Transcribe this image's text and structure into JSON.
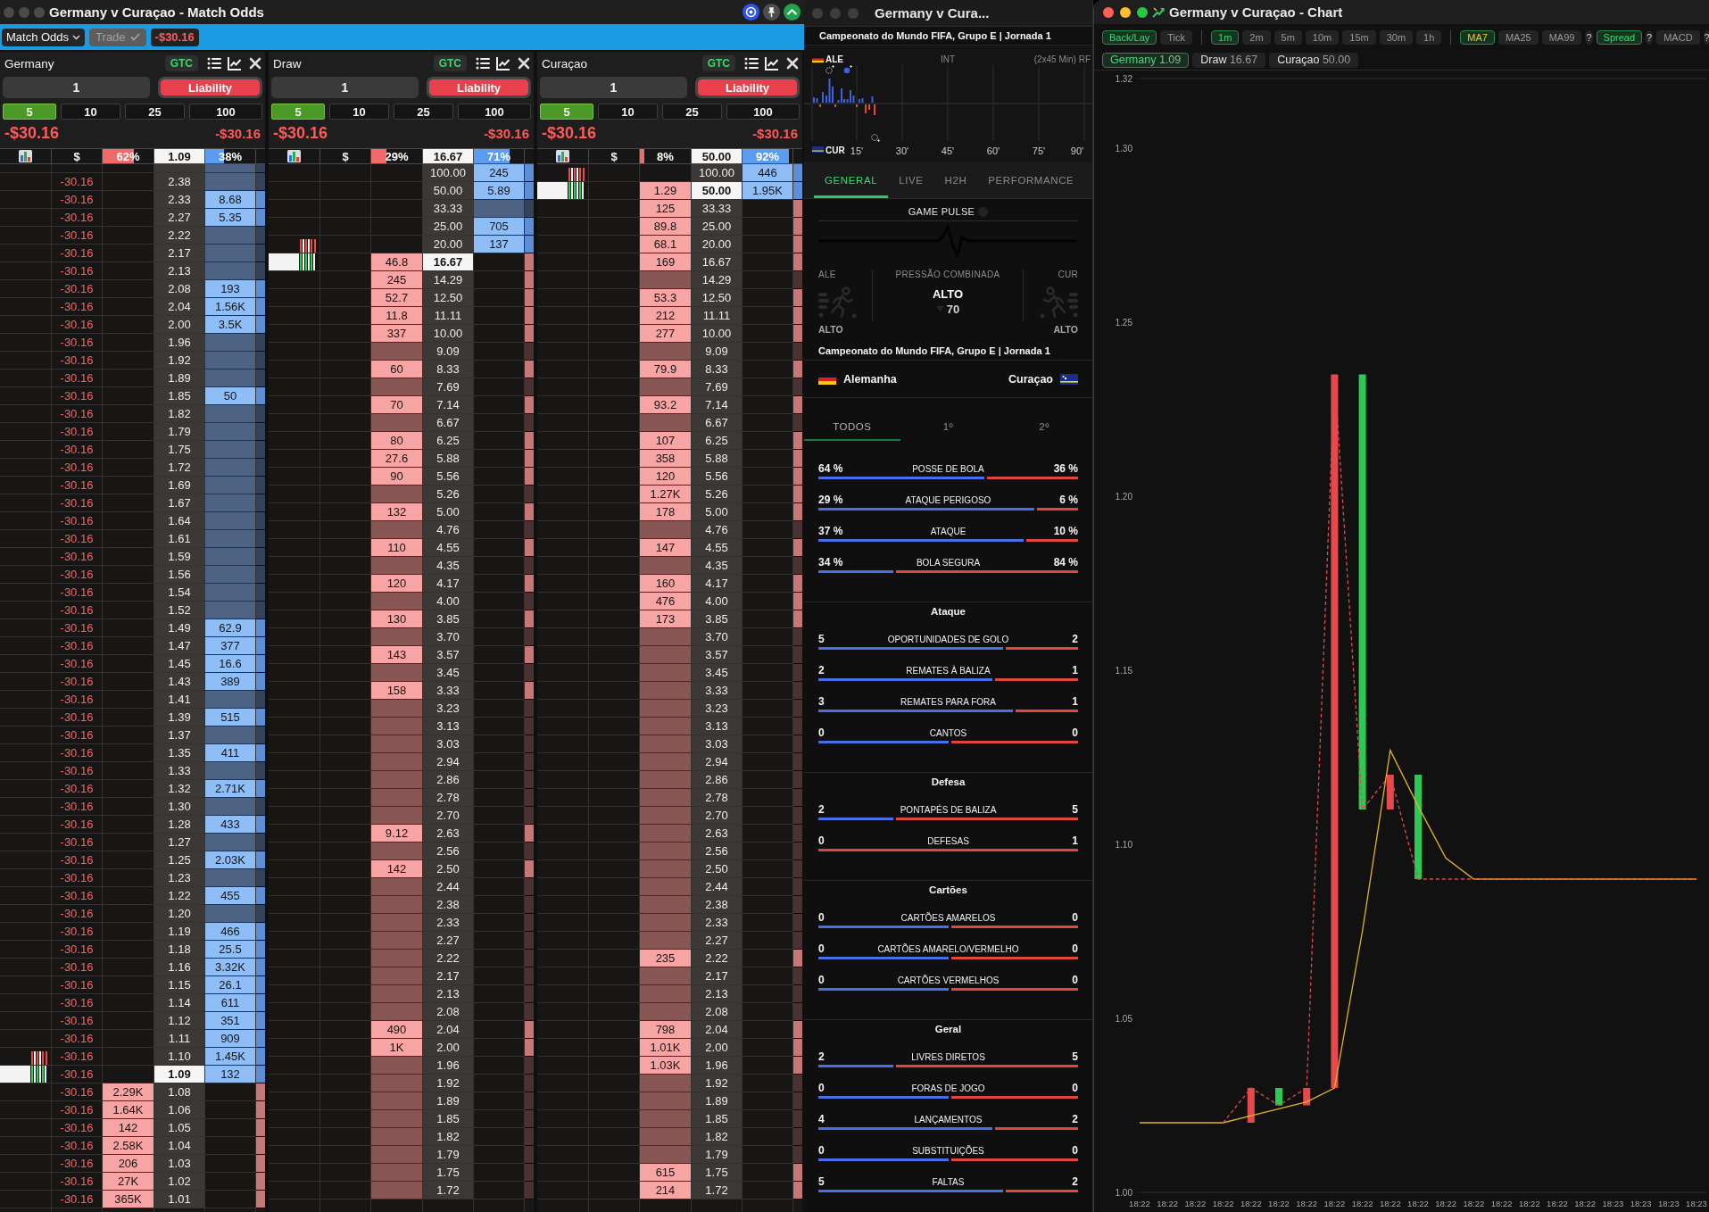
{
  "match_window": {
    "title": "Germany v Curaçao - Match Odds",
    "toolbar": {
      "market": "Match Odds",
      "trade": {
        "label": "Trade",
        "disabled": true
      },
      "total_pl": "-$30.16"
    },
    "ladders": [
      {
        "runner": "Germany",
        "order_type": "GTC",
        "quantity": "1",
        "stake_mode": "Liability",
        "stakes": [
          {
            "label": "5",
            "selected": true
          },
          {
            "label": "10",
            "selected": false
          },
          {
            "label": "25",
            "selected": false
          },
          {
            "label": "100",
            "selected": false
          }
        ],
        "pl": "-$30.16",
        "liability": "-$30.16",
        "columns": {
          "pl": "$",
          "lay_share": {
            "text": "62%",
            "level": 0.62
          },
          "last_price": "1.09",
          "back_share": {
            "text": "38%",
            "level": 0.38
          }
        },
        "half_row_at_top": true,
        "rows": [
          {
            "pl": "-30.16",
            "price": "2.38",
            "ltp": false
          },
          {
            "pl": "-30.16",
            "price": "2.33",
            "back": "8.68",
            "ltp": false
          },
          {
            "pl": "-30.16",
            "price": "2.27",
            "back": "5.35",
            "ltp": false
          },
          {
            "pl": "-30.16",
            "price": "2.22",
            "ltp": false
          },
          {
            "pl": "-30.16",
            "price": "2.17",
            "ltp": false
          },
          {
            "pl": "-30.16",
            "price": "2.13",
            "ltp": false
          },
          {
            "pl": "-30.16",
            "price": "2.08",
            "back": "193",
            "ltp": false
          },
          {
            "pl": "-30.16",
            "price": "2.04",
            "back": "1.56K",
            "ltp": false
          },
          {
            "pl": "-30.16",
            "price": "2.00",
            "back": "3.5K",
            "ltp": false
          },
          {
            "pl": "-30.16",
            "price": "1.96",
            "ltp": false
          },
          {
            "pl": "-30.16",
            "price": "1.92",
            "ltp": false
          },
          {
            "pl": "-30.16",
            "price": "1.89",
            "ltp": false
          },
          {
            "pl": "-30.16",
            "price": "1.85",
            "back": "50",
            "ltp": false
          },
          {
            "pl": "-30.16",
            "price": "1.82",
            "ltp": false
          },
          {
            "pl": "-30.16",
            "price": "1.79",
            "ltp": false
          },
          {
            "pl": "-30.16",
            "price": "1.75",
            "ltp": false
          },
          {
            "pl": "-30.16",
            "price": "1.72",
            "ltp": false
          },
          {
            "pl": "-30.16",
            "price": "1.69",
            "ltp": false
          },
          {
            "pl": "-30.16",
            "price": "1.67",
            "ltp": false
          },
          {
            "pl": "-30.16",
            "price": "1.64",
            "ltp": false
          },
          {
            "pl": "-30.16",
            "price": "1.61",
            "ltp": false
          },
          {
            "pl": "-30.16",
            "price": "1.59",
            "ltp": false
          },
          {
            "pl": "-30.16",
            "price": "1.56",
            "ltp": false
          },
          {
            "pl": "-30.16",
            "price": "1.54",
            "ltp": false
          },
          {
            "pl": "-30.16",
            "price": "1.52",
            "ltp": false
          },
          {
            "pl": "-30.16",
            "price": "1.49",
            "back": "62.9",
            "ltp": false
          },
          {
            "pl": "-30.16",
            "price": "1.47",
            "back": "377",
            "ltp": false
          },
          {
            "pl": "-30.16",
            "price": "1.45",
            "back": "16.6",
            "ltp": false
          },
          {
            "pl": "-30.16",
            "price": "1.43",
            "back": "389",
            "ltp": false
          },
          {
            "pl": "-30.16",
            "price": "1.41",
            "ltp": false
          },
          {
            "pl": "-30.16",
            "price": "1.39",
            "back": "515",
            "ltp": false
          },
          {
            "pl": "-30.16",
            "price": "1.37",
            "ltp": false
          },
          {
            "pl": "-30.16",
            "price": "1.35",
            "back": "411",
            "ltp": false
          },
          {
            "pl": "-30.16",
            "price": "1.33",
            "ltp": false
          },
          {
            "pl": "-30.16",
            "price": "1.32",
            "back": "2.71K",
            "ltp": false
          },
          {
            "pl": "-30.16",
            "price": "1.30",
            "ltp": false
          },
          {
            "pl": "-30.16",
            "price": "1.28",
            "back": "433",
            "ltp": false
          },
          {
            "pl": "-30.16",
            "price": "1.27",
            "ltp": false
          },
          {
            "pl": "-30.16",
            "price": "1.25",
            "back": "2.03K",
            "ltp": false
          },
          {
            "pl": "-30.16",
            "price": "1.23",
            "ltp": false
          },
          {
            "pl": "-30.16",
            "price": "1.22",
            "back": "455",
            "ltp": false
          },
          {
            "pl": "-30.16",
            "price": "1.20",
            "ltp": false
          },
          {
            "pl": "-30.16",
            "price": "1.19",
            "back": "466",
            "ltp": false
          },
          {
            "pl": "-30.16",
            "price": "1.18",
            "back": "25.5",
            "ltp": false
          },
          {
            "pl": "-30.16",
            "price": "1.16",
            "back": "3.32K",
            "ltp": false
          },
          {
            "pl": "-30.16",
            "price": "1.15",
            "back": "26.1",
            "ltp": false
          },
          {
            "pl": "-30.16",
            "price": "1.14",
            "back": "611",
            "ltp": false
          },
          {
            "pl": "-30.16",
            "price": "1.12",
            "back": "351",
            "ltp": false
          },
          {
            "pl": "-30.16",
            "price": "1.11",
            "back": "909",
            "ltp": false
          },
          {
            "pl": "-30.16",
            "price": "1.10",
            "back": "1.45K",
            "ltp": false
          },
          {
            "pl": "-30.16",
            "price": "1.09",
            "back": "132",
            "ltp": true
          },
          {
            "pl": "-30.16",
            "lay": "2.29K",
            "price": "1.08",
            "ltp": false
          },
          {
            "pl": "-30.16",
            "lay": "1.64K",
            "price": "1.06",
            "ltp": false
          },
          {
            "pl": "-30.16",
            "lay": "142",
            "price": "1.05",
            "ltp": false
          },
          {
            "pl": "-30.16",
            "lay": "2.58K",
            "price": "1.04",
            "ltp": false
          },
          {
            "pl": "-30.16",
            "lay": "206",
            "price": "1.03",
            "ltp": false
          },
          {
            "pl": "-30.16",
            "lay": "27K",
            "price": "1.02",
            "ltp": false
          },
          {
            "pl": "-30.16",
            "lay": "365K",
            "price": "1.01",
            "ltp": false
          }
        ]
      },
      {
        "runner": "Draw",
        "order_type": "GTC",
        "quantity": "1",
        "stake_mode": "Liability",
        "stakes": [
          {
            "label": "5",
            "selected": true
          },
          {
            "label": "10",
            "selected": false
          },
          {
            "label": "25",
            "selected": false
          },
          {
            "label": "100",
            "selected": false
          }
        ],
        "pl": "-$30.16",
        "liability": "-$30.16",
        "columns": {
          "pl": "$",
          "lay_share": {
            "text": "29%",
            "level": 0.29
          },
          "last_price": "16.67",
          "back_share": {
            "text": "71%",
            "level": 0.71
          }
        },
        "half_row_at_top": false,
        "rows": [
          {
            "price": "100.00",
            "back": "245",
            "ltp": false
          },
          {
            "price": "50.00",
            "back": "5.89",
            "ltp": false
          },
          {
            "price": "33.33",
            "ltp": false
          },
          {
            "price": "25.00",
            "back": "705",
            "ltp": false
          },
          {
            "price": "20.00",
            "back": "137",
            "ltp": false
          },
          {
            "lay": "46.8",
            "price": "16.67",
            "ltp": true
          },
          {
            "lay": "245",
            "price": "14.29",
            "ltp": false
          },
          {
            "lay": "52.7",
            "price": "12.50",
            "ltp": false
          },
          {
            "lay": "11.8",
            "price": "11.11",
            "ltp": false
          },
          {
            "lay": "337",
            "price": "10.00",
            "ltp": false
          },
          {
            "price": "9.09",
            "ltp": false
          },
          {
            "lay": "60",
            "price": "8.33",
            "ltp": false
          },
          {
            "price": "7.69",
            "ltp": false
          },
          {
            "lay": "70",
            "price": "7.14",
            "ltp": false
          },
          {
            "price": "6.67",
            "ltp": false
          },
          {
            "lay": "80",
            "price": "6.25",
            "ltp": false
          },
          {
            "lay": "27.6",
            "price": "5.88",
            "ltp": false
          },
          {
            "lay": "90",
            "price": "5.56",
            "ltp": false
          },
          {
            "price": "5.26",
            "ltp": false
          },
          {
            "lay": "132",
            "price": "5.00",
            "ltp": false
          },
          {
            "price": "4.76",
            "ltp": false
          },
          {
            "lay": "110",
            "price": "4.55",
            "ltp": false
          },
          {
            "price": "4.35",
            "ltp": false
          },
          {
            "lay": "120",
            "price": "4.17",
            "ltp": false
          },
          {
            "price": "4.00",
            "ltp": false
          },
          {
            "lay": "130",
            "price": "3.85",
            "ltp": false
          },
          {
            "price": "3.70",
            "ltp": false
          },
          {
            "lay": "143",
            "price": "3.57",
            "ltp": false
          },
          {
            "price": "3.45",
            "ltp": false
          },
          {
            "lay": "158",
            "price": "3.33",
            "ltp": false
          },
          {
            "price": "3.23",
            "ltp": false
          },
          {
            "price": "3.13",
            "ltp": false
          },
          {
            "price": "3.03",
            "ltp": false
          },
          {
            "price": "2.94",
            "ltp": false
          },
          {
            "price": "2.86",
            "ltp": false
          },
          {
            "price": "2.78",
            "ltp": false
          },
          {
            "price": "2.70",
            "ltp": false
          },
          {
            "lay": "9.12",
            "price": "2.63",
            "ltp": false
          },
          {
            "price": "2.56",
            "ltp": false
          },
          {
            "lay": "142",
            "price": "2.50",
            "ltp": false
          },
          {
            "price": "2.44",
            "ltp": false
          },
          {
            "price": "2.38",
            "ltp": false
          },
          {
            "price": "2.33",
            "ltp": false
          },
          {
            "price": "2.27",
            "ltp": false
          },
          {
            "price": "2.22",
            "ltp": false
          },
          {
            "price": "2.17",
            "ltp": false
          },
          {
            "price": "2.13",
            "ltp": false
          },
          {
            "price": "2.08",
            "ltp": false
          },
          {
            "lay": "490",
            "price": "2.04",
            "ltp": false
          },
          {
            "lay": "1K",
            "price": "2.00",
            "ltp": false
          },
          {
            "price": "1.96",
            "ltp": false
          },
          {
            "price": "1.92",
            "ltp": false
          },
          {
            "price": "1.89",
            "ltp": false
          },
          {
            "price": "1.85",
            "ltp": false
          },
          {
            "price": "1.82",
            "ltp": false
          },
          {
            "price": "1.79",
            "ltp": false
          },
          {
            "price": "1.75",
            "ltp": false
          },
          {
            "price": "1.72",
            "ltp": false
          }
        ]
      },
      {
        "runner": "Curaçao",
        "order_type": "GTC",
        "quantity": "1",
        "stake_mode": "Liability",
        "stakes": [
          {
            "label": "5",
            "selected": true
          },
          {
            "label": "10",
            "selected": false
          },
          {
            "label": "25",
            "selected": false
          },
          {
            "label": "100",
            "selected": false
          }
        ],
        "pl": "-$30.16",
        "liability": "-$30.16",
        "columns": {
          "pl": "$",
          "lay_share": {
            "text": "8%",
            "level": 0.08
          },
          "last_price": "50.00",
          "back_share": {
            "text": "92%",
            "level": 0.92
          }
        },
        "half_row_at_top": false,
        "rows": [
          {
            "price": "100.00",
            "back": "446",
            "ltp": false
          },
          {
            "lay": "1.29",
            "price": "50.00",
            "back": "1.95K",
            "ltp": true
          },
          {
            "lay": "125",
            "price": "33.33",
            "ltp": false
          },
          {
            "lay": "89.8",
            "price": "25.00",
            "ltp": false
          },
          {
            "lay": "68.1",
            "price": "20.00",
            "ltp": false
          },
          {
            "lay": "169",
            "price": "16.67",
            "ltp": false
          },
          {
            "price": "14.29",
            "ltp": false
          },
          {
            "lay": "53.3",
            "price": "12.50",
            "ltp": false
          },
          {
            "lay": "212",
            "price": "11.11",
            "ltp": false
          },
          {
            "lay": "277",
            "price": "10.00",
            "ltp": false
          },
          {
            "price": "9.09",
            "ltp": false
          },
          {
            "lay": "79.9",
            "price": "8.33",
            "ltp": false
          },
          {
            "price": "7.69",
            "ltp": false
          },
          {
            "lay": "93.2",
            "price": "7.14",
            "ltp": false
          },
          {
            "price": "6.67",
            "ltp": false
          },
          {
            "lay": "107",
            "price": "6.25",
            "ltp": false
          },
          {
            "lay": "358",
            "price": "5.88",
            "ltp": false
          },
          {
            "lay": "120",
            "price": "5.56",
            "ltp": false
          },
          {
            "lay": "1.27K",
            "price": "5.26",
            "ltp": false
          },
          {
            "lay": "178",
            "price": "5.00",
            "ltp": false
          },
          {
            "price": "4.76",
            "ltp": false
          },
          {
            "lay": "147",
            "price": "4.55",
            "ltp": false
          },
          {
            "price": "4.35",
            "ltp": false
          },
          {
            "lay": "160",
            "price": "4.17",
            "ltp": false
          },
          {
            "lay": "476",
            "price": "4.00",
            "ltp": false
          },
          {
            "lay": "173",
            "price": "3.85",
            "ltp": false
          },
          {
            "price": "3.70",
            "ltp": false
          },
          {
            "price": "3.57",
            "ltp": false
          },
          {
            "price": "3.45",
            "ltp": false
          },
          {
            "price": "3.33",
            "ltp": false
          },
          {
            "price": "3.23",
            "ltp": false
          },
          {
            "price": "3.13",
            "ltp": false
          },
          {
            "price": "3.03",
            "ltp": false
          },
          {
            "price": "2.94",
            "ltp": false
          },
          {
            "price": "2.86",
            "ltp": false
          },
          {
            "price": "2.78",
            "ltp": false
          },
          {
            "price": "2.70",
            "ltp": false
          },
          {
            "price": "2.63",
            "ltp": false
          },
          {
            "price": "2.56",
            "ltp": false
          },
          {
            "price": "2.50",
            "ltp": false
          },
          {
            "price": "2.44",
            "ltp": false
          },
          {
            "price": "2.38",
            "ltp": false
          },
          {
            "price": "2.33",
            "ltp": false
          },
          {
            "price": "2.27",
            "ltp": false
          },
          {
            "lay": "235",
            "price": "2.22",
            "ltp": false
          },
          {
            "price": "2.17",
            "ltp": false
          },
          {
            "price": "2.13",
            "ltp": false
          },
          {
            "price": "2.08",
            "ltp": false
          },
          {
            "lay": "798",
            "price": "2.04",
            "ltp": false
          },
          {
            "lay": "1.01K",
            "price": "2.00",
            "ltp": false
          },
          {
            "lay": "1.03K",
            "price": "1.96",
            "ltp": false
          },
          {
            "price": "1.92",
            "ltp": false
          },
          {
            "price": "1.89",
            "ltp": false
          },
          {
            "price": "1.85",
            "ltp": false
          },
          {
            "price": "1.82",
            "ltp": false
          },
          {
            "price": "1.79",
            "ltp": false
          },
          {
            "lay": "615",
            "price": "1.75",
            "ltp": false
          },
          {
            "lay": "214",
            "price": "1.72",
            "ltp": false
          }
        ]
      }
    ]
  },
  "stats_window": {
    "title": "Germany v Cura...",
    "competition": "Campeonato do Mundo FIFA, Grupo E | Jornada 1",
    "momentum": {
      "home": "ALE",
      "away": "CUR",
      "period": "INT",
      "format": "(2x45 Min) RF",
      "minutes": [
        "15'",
        "30'",
        "45'",
        "60'",
        "75'",
        "90'"
      ]
    },
    "tabs": [
      {
        "label": "GENERAL",
        "selected": true
      },
      {
        "label": "LIVE",
        "selected": false
      },
      {
        "label": "H2H",
        "selected": false
      },
      {
        "label": "PERFORMANCE",
        "selected": false
      }
    ],
    "pulse": {
      "title": "GAME PULSE",
      "home": "ALE",
      "label": "PRESSÃO COMBINADA",
      "away": "CUR",
      "rating": "ALTO",
      "value": "70",
      "home_rating": "ALTO",
      "away_rating": "ALTO"
    },
    "fixture": {
      "competition": "Campeonato do Mundo FIFA, Grupo E | Jornada 1",
      "home": "Alemanha",
      "away": "Curaçao"
    },
    "period_tabs": [
      {
        "label": "TODOS",
        "selected": true
      },
      {
        "label": "1º",
        "selected": false
      },
      {
        "label": "2º",
        "selected": false
      }
    ],
    "sections": [
      {
        "stats": [
          {
            "home": "64 %",
            "label": "POSSE DE BOLA",
            "away": "36 %",
            "level": 0.64
          },
          {
            "home": "29 %",
            "label": "ATAQUE PERIGOSO",
            "away": "6 %",
            "level": 0.83
          },
          {
            "home": "37 %",
            "label": "ATAQUE",
            "away": "10 %",
            "level": 0.79
          },
          {
            "home": "34 %",
            "label": "BOLA SEGURA",
            "away": "84 %",
            "level": 0.29
          }
        ]
      },
      {
        "title": "Ataque",
        "stats": [
          {
            "home": "5",
            "label": "OPORTUNIDADES DE GOLO",
            "away": "2",
            "level": 0.71
          },
          {
            "home": "2",
            "label": "REMATES À BALIZA",
            "away": "1",
            "level": 0.67
          },
          {
            "home": "3",
            "label": "REMATES PARA FORA",
            "away": "1",
            "level": 0.75
          },
          {
            "home": "0",
            "label": "CANTOS",
            "away": "0",
            "level": 0.5
          }
        ]
      },
      {
        "title": "Defesa",
        "stats": [
          {
            "home": "2",
            "label": "PONTAPÉS DE BALIZA",
            "away": "5",
            "level": 0.29
          },
          {
            "home": "0",
            "label": "DEFESAS",
            "away": "1",
            "level": 0
          }
        ]
      },
      {
        "title": "Cartões",
        "stats": [
          {
            "home": "0",
            "label": "CARTÕES AMARELOS",
            "away": "0",
            "level": 0.5
          },
          {
            "home": "0",
            "label": "CARTÕES AMARELO/VERMELHO",
            "away": "0",
            "level": 0.5
          },
          {
            "home": "0",
            "label": "CARTÕES VERMELHOS",
            "away": "0",
            "level": 0.5
          }
        ]
      },
      {
        "title": "Geral",
        "stats": [
          {
            "home": "2",
            "label": "LIVRES DIRETOS",
            "away": "5",
            "level": 0.29
          },
          {
            "home": "0",
            "label": "FORAS DE JOGO",
            "away": "0",
            "level": 0.5
          },
          {
            "home": "4",
            "label": "LANÇAMENTOS",
            "away": "2",
            "level": 0.67
          },
          {
            "home": "0",
            "label": "SUBSTITUIÇÕES",
            "away": "0",
            "level": 0.5
          },
          {
            "home": "5",
            "label": "FALTAS",
            "away": "2",
            "level": 0.71
          }
        ]
      }
    ]
  },
  "chart_window": {
    "title": "Germany v Curaçao - Chart",
    "toolbar_groups": [
      {
        "items": [
          {
            "label": "Back/Lay",
            "kind": "toggle",
            "selected": true
          },
          {
            "label": "Tick",
            "kind": "toggle",
            "selected": false
          }
        ]
      },
      {
        "items": [
          {
            "label": "1m",
            "kind": "toggle",
            "selected": true
          },
          {
            "label": "2m",
            "kind": "toggle",
            "selected": false
          },
          {
            "label": "5m",
            "kind": "toggle",
            "selected": false
          },
          {
            "label": "10m",
            "kind": "toggle",
            "selected": false
          },
          {
            "label": "15m",
            "kind": "toggle",
            "selected": false
          },
          {
            "label": "30m",
            "kind": "toggle",
            "selected": false
          },
          {
            "label": "1h",
            "kind": "toggle",
            "selected": false
          }
        ]
      },
      {
        "items": [
          {
            "label": "MA7",
            "kind": "average",
            "selected": true
          },
          {
            "label": "MA25",
            "kind": "average",
            "selected": false
          },
          {
            "label": "MA99",
            "kind": "average",
            "selected": false
          },
          {
            "label": "?",
            "kind": "help",
            "selected": false
          },
          {
            "label": "Spread",
            "kind": "toggle",
            "selected": true
          },
          {
            "label": "?",
            "kind": "help",
            "selected": false
          },
          {
            "label": "MACD",
            "kind": "toggle",
            "selected": false
          },
          {
            "label": "?",
            "kind": "help",
            "selected": false
          }
        ]
      }
    ],
    "runners": [
      {
        "name": "Germany",
        "price": "1.09",
        "selected": true
      },
      {
        "name": "Draw",
        "price": "16.67",
        "selected": false
      },
      {
        "name": "Curaçao",
        "price": "50.00",
        "selected": false
      }
    ],
    "chart_data": {
      "type": "line",
      "categories": [
        "18:22",
        "18:22",
        "18:22",
        "18:22",
        "18:22",
        "18:22",
        "18:22",
        "18:22",
        "18:22",
        "18:22",
        "18:22",
        "18:22",
        "18:22",
        "18:22",
        "18:22",
        "18:22",
        "18:22",
        "18:23",
        "18:23",
        "18:23",
        "18:23"
      ],
      "ylim": [
        1.0,
        1.32
      ],
      "yticks": [
        {
          "value": 1.0,
          "label": "1.00"
        },
        {
          "value": 1.05,
          "label": "1.05"
        },
        {
          "value": 1.1,
          "label": "1.10"
        },
        {
          "value": 1.15,
          "label": "1.15"
        },
        {
          "value": 1.2,
          "label": "1.20"
        },
        {
          "value": 1.25,
          "label": "1.25"
        },
        {
          "value": 1.3,
          "label": "1.30"
        },
        {
          "value": 1.32,
          "label": "1.32"
        }
      ],
      "series": [
        {
          "color": "#e5484d",
          "line_style": "dashed",
          "values": [
            null,
            null,
            null,
            1.02,
            1.03,
            1.025,
            1.03,
            1.235,
            1.11,
            1.12,
            1.09,
            1.09,
            1.09,
            1.09,
            1.09,
            1.09,
            1.09,
            1.09,
            1.09,
            1.09,
            1.09
          ]
        },
        {
          "color": "#e3b526",
          "line_style": "solid",
          "values": [
            1.02,
            1.02,
            1.02,
            1.02,
            1.022,
            1.024,
            1.026,
            1.03,
            1.075,
            1.127,
            1.111,
            1.096,
            1.09,
            1.09,
            1.09,
            1.09,
            1.09,
            1.09,
            1.09,
            1.09,
            1.09
          ]
        }
      ]
    }
  }
}
